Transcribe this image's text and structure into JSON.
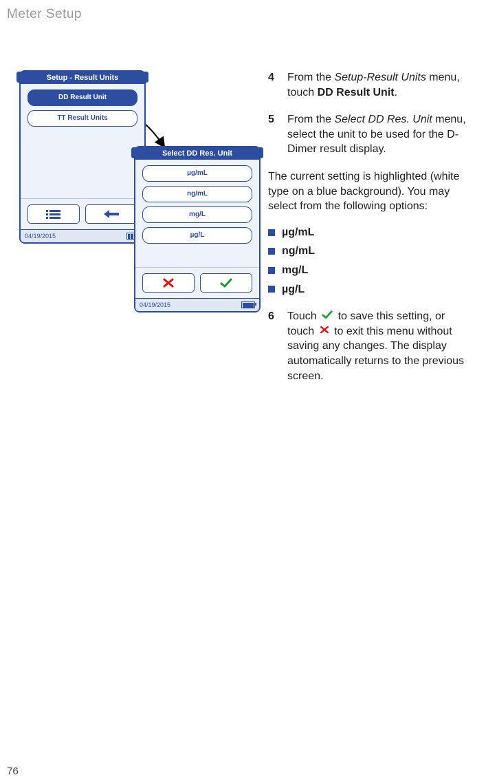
{
  "header": "Meter Setup",
  "page_number": "76",
  "screens": {
    "setup": {
      "title": "Setup - Result Units",
      "items": [
        {
          "label": "DD Result Unit",
          "selected": true
        },
        {
          "label": "TT Result Units",
          "selected": false
        }
      ],
      "date": "04/19/2015"
    },
    "select": {
      "title": "Select DD Res. Unit",
      "options": [
        "µg/mL",
        "ng/mL",
        "mg/L",
        "µg/L"
      ],
      "date": "04/19/2015"
    }
  },
  "steps": {
    "s4": {
      "num": "4",
      "pre": "From the ",
      "menu": "Setup-Result Units",
      "mid": " menu, touch ",
      "target": "DD Result Unit",
      "post": "."
    },
    "s5": {
      "num": "5",
      "pre": "From the ",
      "menu": "Select DD Res. Unit",
      "post": " menu, select the unit to be used for the D-Dimer result display."
    },
    "intro": "The current setting is highlighted (white type on a blue background). You may select from the following options:",
    "options": [
      "µg/mL",
      "ng/mL",
      "mg/L",
      "µg/L"
    ],
    "s6": {
      "num": "6",
      "p1": "Touch ",
      "p2": " to save this setting, or touch ",
      "p3": " to exit this menu without saving any changes. The display automatically returns to the previous screen."
    }
  }
}
